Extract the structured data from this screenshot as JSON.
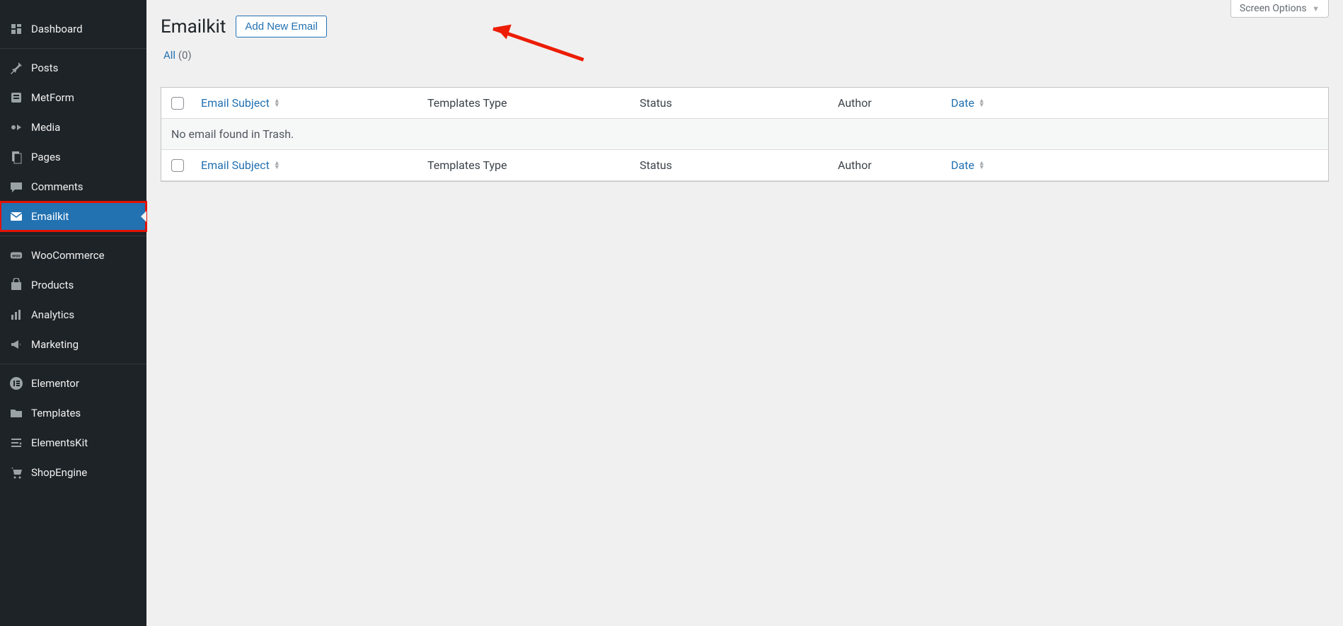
{
  "sidebar": {
    "items": [
      {
        "label": "Dashboard",
        "icon": "dashboard"
      },
      {
        "label": "Posts",
        "icon": "pin"
      },
      {
        "label": "MetForm",
        "icon": "metform"
      },
      {
        "label": "Media",
        "icon": "media"
      },
      {
        "label": "Pages",
        "icon": "pages"
      },
      {
        "label": "Comments",
        "icon": "comments"
      },
      {
        "label": "Emailkit",
        "icon": "email",
        "active": true,
        "highlighted": true
      },
      {
        "label": "WooCommerce",
        "icon": "woo"
      },
      {
        "label": "Products",
        "icon": "products"
      },
      {
        "label": "Analytics",
        "icon": "analytics"
      },
      {
        "label": "Marketing",
        "icon": "marketing"
      },
      {
        "label": "Elementor",
        "icon": "elementor"
      },
      {
        "label": "Templates",
        "icon": "templates"
      },
      {
        "label": "ElementsKit",
        "icon": "elementskit"
      },
      {
        "label": "ShopEngine",
        "icon": "shopengine"
      }
    ]
  },
  "header": {
    "screen_options_label": "Screen Options",
    "page_title": "Emailkit",
    "add_new_label": "Add New Email"
  },
  "filter": {
    "all_label": "All",
    "all_count": "(0)"
  },
  "table": {
    "col_subject": "Email Subject",
    "col_templates": "Templates Type",
    "col_status": "Status",
    "col_author": "Author",
    "col_date": "Date",
    "empty_message": "No email found in Trash."
  }
}
